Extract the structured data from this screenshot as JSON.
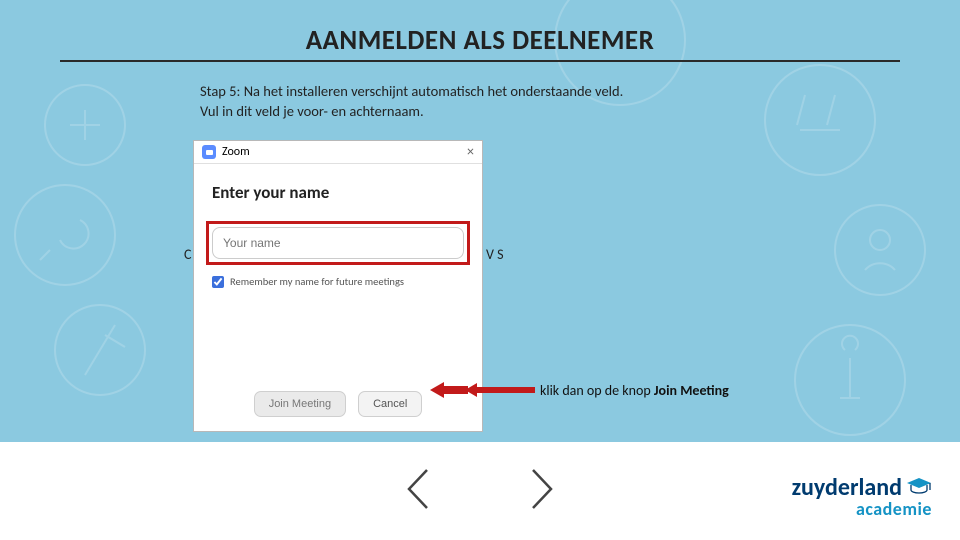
{
  "title": "AANMELDEN ALS DEELNEMER",
  "step": {
    "line1": "Stap 5: Na het installeren verschijnt automatisch het onderstaande veld.",
    "line2": "Vul in dit veld je voor- en achternaam."
  },
  "dialog": {
    "app_name": "Zoom",
    "heading": "Enter your name",
    "name_placeholder": "Your name",
    "remember_label": "Remember my name for future meetings",
    "join_label": "Join Meeting",
    "cancel_label": "Cancel"
  },
  "hint": {
    "prefix": "klik dan op de knop ",
    "bold": "Join Meeting"
  },
  "brand": {
    "line1": "zuyderland",
    "line2": "academie"
  },
  "icons": {
    "close": "close-icon",
    "zoom": "zoom-icon",
    "checkbox": "checkbox-remember",
    "prev": "nav-prev",
    "next": "nav-next",
    "arrow_to_join": "red-arrow-to-join",
    "arrow_bar": "red-arrow-bar",
    "cap": "graduation-cap-icon"
  }
}
